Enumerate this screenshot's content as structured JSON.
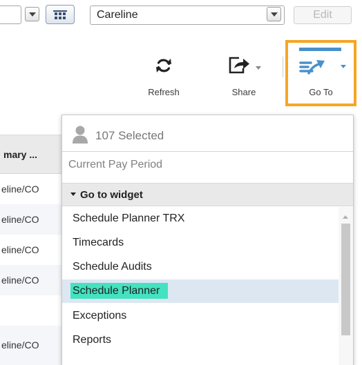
{
  "toolbar": {
    "combo_value": "Careline",
    "edit_label": "Edit"
  },
  "actions": {
    "refresh_label": "Refresh",
    "share_label": "Share",
    "goto_label": "Go To"
  },
  "grid": {
    "column_header": "mary ...",
    "cells": [
      "eline/CO",
      "eline/CO",
      "eline/CO",
      "eline/CO",
      "",
      "eline/CO"
    ]
  },
  "dropdown": {
    "selected_text": "107 Selected",
    "pay_period": "Current Pay Period",
    "section_title": "Go to widget",
    "items": [
      {
        "label": "Schedule Planner TRX"
      },
      {
        "label": "Timecards"
      },
      {
        "label": "Schedule Audits"
      },
      {
        "label": "Schedule Planner"
      },
      {
        "label": "Exceptions"
      },
      {
        "label": "Reports"
      }
    ]
  },
  "colors": {
    "highlight_frame": "#f6a623",
    "accent_blue": "#4a90c9",
    "active_item_bg": "#dce7f2",
    "active_item_mark": "#43e2c0"
  }
}
